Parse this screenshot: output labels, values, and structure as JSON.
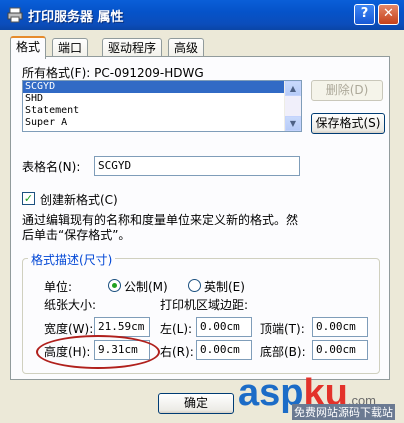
{
  "window": {
    "title": "打印服务器 属性",
    "help_label": "?",
    "close_label": "✕"
  },
  "tabs": [
    {
      "label": "格式",
      "active": true
    },
    {
      "label": "端口"
    },
    {
      "label": "驱动程序"
    },
    {
      "label": "高级"
    }
  ],
  "formats": {
    "label": "所有格式(F): PC-091209-HDWG",
    "items": [
      "SCGYD",
      "SHD",
      "Statement",
      "Super A"
    ],
    "selected_index": 0,
    "delete_button": "删除(D)",
    "save_button": "保存格式(S)"
  },
  "form_name": {
    "label": "表格名(N):",
    "value": "SCGYD"
  },
  "create_new": {
    "label": "创建新格式(C)",
    "checked": true
  },
  "hint": {
    "line1": "通过编辑现有的名称和度量单位来定义新的格式。然",
    "line2": "后单击“保存格式”。"
  },
  "format_desc": {
    "title": "格式描述(尺寸)",
    "unit_label": "单位:",
    "metric_label": "公制(M)",
    "imperial_label": "英制(E)",
    "selected_unit": "metric",
    "paper_size_label": "纸张大小:",
    "margins_label": "打印机区域边距:",
    "width_label": "宽度(W):",
    "width_value": "21.59cm",
    "height_label": "高度(H):",
    "height_value": "9.31cm",
    "left_label": "左(L):",
    "left_value": "0.00cm",
    "right_label": "右(R):",
    "right_value": "0.00cm",
    "top_label": "顶端(T):",
    "top_value": "0.00cm",
    "bottom_label": "底部(B):",
    "bottom_value": "0.00cm"
  },
  "buttons": {
    "ok": "确定"
  },
  "watermark": {
    "brand_a": "asp",
    "brand_b": "ku",
    "suffix": ".com",
    "subtitle": "免费网站源码下载站"
  },
  "colors": {
    "titlebar": "#0553c9",
    "selection": "#316ac5",
    "group_title": "#0046d5",
    "highlight_oval": "#b0201c"
  }
}
